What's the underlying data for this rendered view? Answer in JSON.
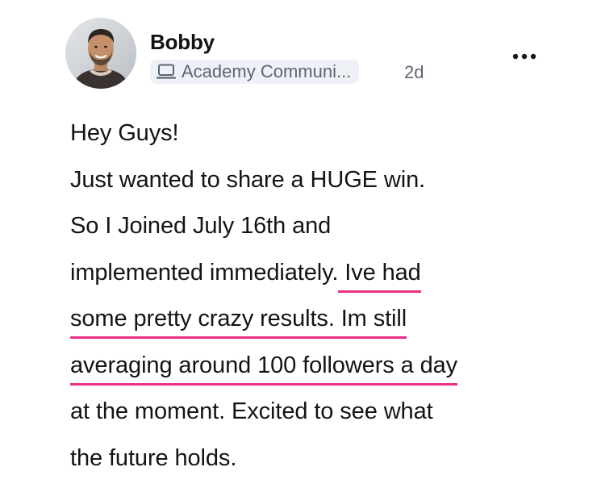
{
  "post": {
    "author": {
      "name": "Bobby",
      "avatar_icon": "profile-photo"
    },
    "community": {
      "icon": "laptop-icon",
      "label": "Academy Communi..."
    },
    "timestamp": "2d",
    "more_icon": "more-horizontal-icon",
    "underline_color": "#ea2f84",
    "body_lines": [
      {
        "text": "Hey Guys!"
      },
      {
        "text": "Just wanted to share a HUGE win."
      },
      {
        "text": "So I Joined July 16th and"
      },
      {
        "pre": "implemented immediately.",
        "highlight": " Ive had"
      },
      {
        "highlight": "some pretty crazy results. Im still"
      },
      {
        "highlight": "averaging around 100 followers a day"
      },
      {
        "text": "at the moment. Excited to see what"
      },
      {
        "text": "the future holds."
      }
    ]
  }
}
